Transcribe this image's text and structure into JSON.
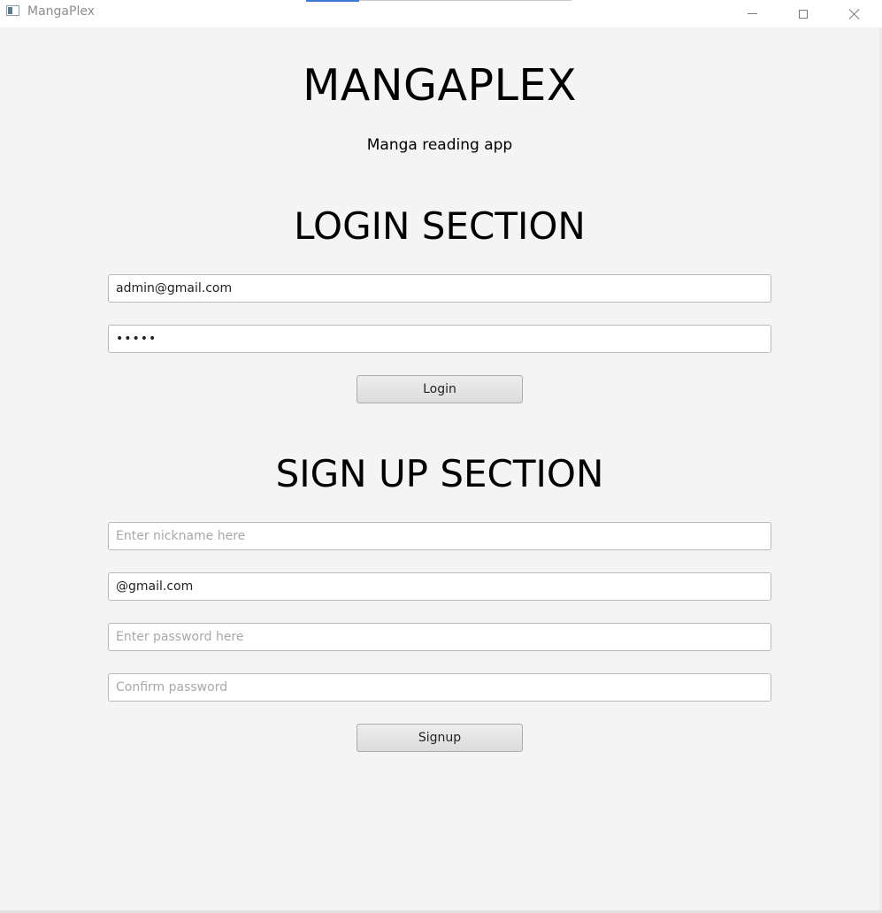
{
  "window": {
    "title": "MangaPlex",
    "icon": "app-window-icon",
    "controls": {
      "minimize_icon": "minimize-icon",
      "maximize_icon": "maximize-icon",
      "close_icon": "close-icon"
    }
  },
  "header": {
    "title": "MANGAPLEX",
    "subtitle": "Manga reading app"
  },
  "login": {
    "heading": "LOGIN SECTION",
    "email_value": "admin@gmail.com",
    "password_value": "admin",
    "button_label": "Login"
  },
  "signup": {
    "heading": "SIGN UP SECTION",
    "nickname_placeholder": "Enter nickname here",
    "email_value": "@gmail.com",
    "password_placeholder": "Enter password here",
    "confirm_placeholder": "Confirm password",
    "button_label": "Signup"
  },
  "colors": {
    "background": "#f4f4f4",
    "titlebar": "#ffffff",
    "accent": "#3b78d8",
    "button": "#e5e5e5"
  }
}
